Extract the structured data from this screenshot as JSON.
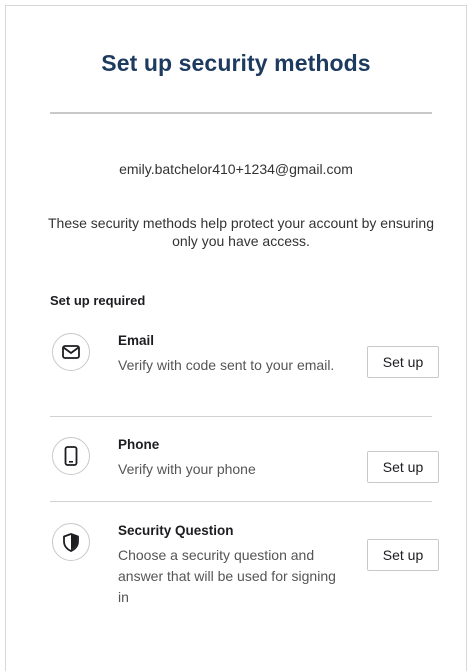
{
  "title": "Set up security methods",
  "identifier": "emily.batchelor410+1234@gmail.com",
  "subtitle": "These security methods help protect your account by ensuring only you have access.",
  "section_label": "Set up required",
  "methods": [
    {
      "name": "Email",
      "description": "Verify with code sent to your email.",
      "button": "Set up",
      "icon": "mail-icon"
    },
    {
      "name": "Phone",
      "description": "Verify with your phone",
      "button": "Set up",
      "icon": "phone-icon"
    },
    {
      "name": "Security Question",
      "description": "Choose a security question and answer that will be used for signing in",
      "button": "Set up",
      "icon": "shield-icon"
    }
  ]
}
